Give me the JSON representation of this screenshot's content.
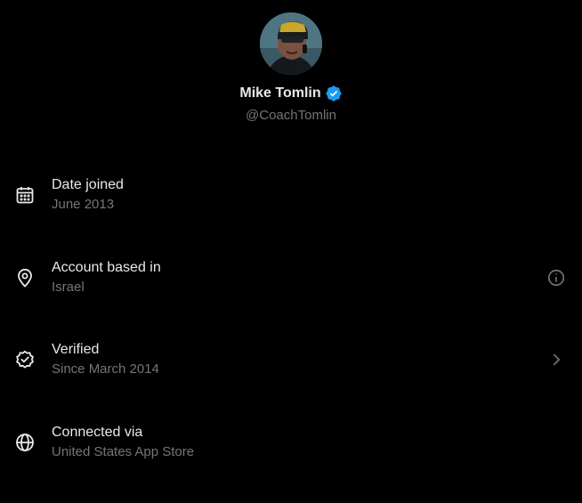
{
  "profile": {
    "name": "Mike Tomlin",
    "handle": "@CoachTomlin",
    "verified_badge_icon": "verified-badge-icon",
    "badge_color": "#1d9bf0"
  },
  "rows": [
    {
      "title": "Date joined",
      "subtitle": "June 2013",
      "icon": "calendar-icon"
    },
    {
      "title": "Account based in",
      "subtitle": "Israel",
      "icon": "location-pin-icon",
      "action_icon": "info-icon"
    },
    {
      "title": "Verified",
      "subtitle": "Since March 2014",
      "icon": "verified-check-icon",
      "action_icon": "chevron-right-icon"
    },
    {
      "title": "Connected via",
      "subtitle": "United States App Store",
      "icon": "globe-icon"
    }
  ],
  "colors": {
    "background": "#000000",
    "primary_text": "#e7e9ea",
    "secondary_text": "#71767b"
  }
}
